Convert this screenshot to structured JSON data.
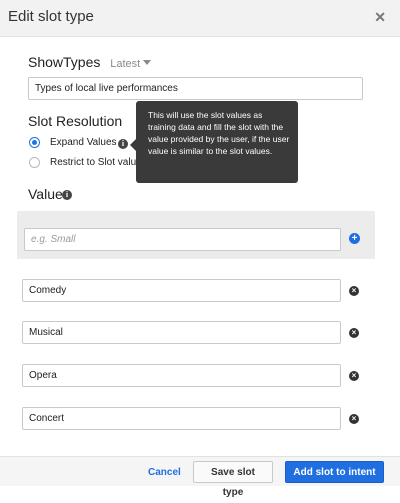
{
  "dialog": {
    "title": "Edit slot type",
    "close_icon": "close-icon"
  },
  "slot_type": {
    "name": "ShowTypes",
    "version": "Latest",
    "description": "Types of local live performances"
  },
  "slot_resolution": {
    "title": "Slot Resolution",
    "options": [
      {
        "label": "Expand Values",
        "checked": true
      },
      {
        "label": "Restrict to Slot values",
        "checked": false
      }
    ],
    "tooltip": "This will use the slot values as training data and fill the slot with the value provided by the user, if the user value is similar to the slot values."
  },
  "values_section": {
    "title": "Value",
    "new_value_placeholder": "e.g. Small",
    "values": [
      "Comedy",
      "Musical",
      "Opera",
      "Concert"
    ]
  },
  "footer": {
    "cancel_label": "Cancel",
    "save_label": "Save slot type",
    "add_label": "Add slot to intent"
  },
  "colors": {
    "accent": "#1f6fe0",
    "tooltip_bg": "#3a3a3a"
  }
}
